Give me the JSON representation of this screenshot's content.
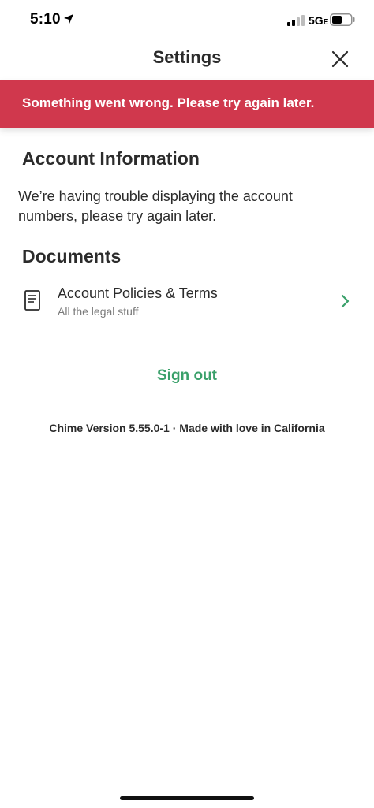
{
  "status_bar": {
    "time": "5:10",
    "network": "5G",
    "network_suffix": "E",
    "icons": [
      "location-arrow-icon",
      "signal-bars-icon",
      "battery-icon"
    ]
  },
  "header": {
    "title": "Settings",
    "close_icon": "close-icon"
  },
  "error_banner": {
    "message": "Something went wrong. Please try again later.",
    "color": "#d0384d"
  },
  "account_information": {
    "heading": "Account Information",
    "message": "We’re having trouble displaying the account numbers, please try again later."
  },
  "documents": {
    "heading": "Documents",
    "items": [
      {
        "title": "Account Policies & Terms",
        "subtitle": "All the legal stuff",
        "icon": "document-icon"
      }
    ]
  },
  "sign_out": {
    "label": "Sign out",
    "color": "#3aa06a"
  },
  "footer": {
    "version_text": "Chime Version 5.55.0-1 · Made with love in California"
  }
}
